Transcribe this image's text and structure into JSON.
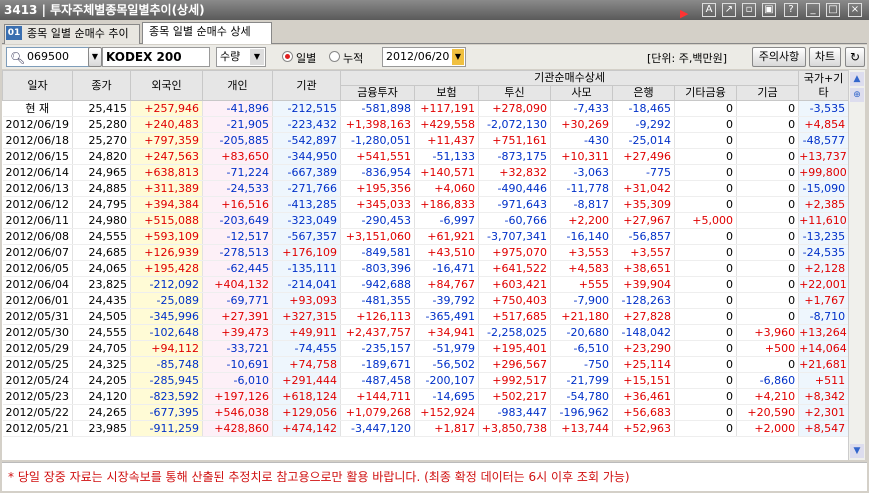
{
  "window": {
    "title": "3413 | 투자주체별종목일별추이(상세)"
  },
  "tabs": [
    {
      "label": "종목 일별 순매수 추이"
    },
    {
      "label": "종목 일별 순매수 상세"
    }
  ],
  "tab_badge": "01",
  "toolbar": {
    "code": "069500",
    "name": "KODEX 200",
    "unit_select": "수량",
    "radio_daily": "일별",
    "radio_cumulative": "누적",
    "date": "2012/06/20",
    "unit_label": "[단위: 주,백만원]",
    "notice_button": "주의사항",
    "chart_button": "차트"
  },
  "table": {
    "group_header": "기관순매수상세",
    "headers": [
      "일자",
      "종가",
      "외국인",
      "개인",
      "기관",
      "금융투자",
      "보험",
      "투신",
      "사모",
      "은행",
      "기타금융",
      "기금",
      "국가+기타"
    ],
    "rows": [
      [
        "현  재",
        "25,415",
        "+257,946",
        "-41,896",
        "-212,515",
        "-581,898",
        "+117,191",
        "+278,090",
        "-7,433",
        "-18,465",
        "0",
        "0",
        "-3,535"
      ],
      [
        "2012/06/19",
        "25,280",
        "+240,483",
        "-21,905",
        "-223,432",
        "+1,398,163",
        "+429,558",
        "-2,072,130",
        "+30,269",
        "-9,292",
        "0",
        "0",
        "+4,854"
      ],
      [
        "2012/06/18",
        "25,270",
        "+797,359",
        "-205,885",
        "-542,897",
        "-1,280,051",
        "+11,437",
        "+751,161",
        "-430",
        "-25,014",
        "0",
        "0",
        "-48,577"
      ],
      [
        "2012/06/15",
        "24,820",
        "+247,563",
        "+83,650",
        "-344,950",
        "+541,551",
        "-51,133",
        "-873,175",
        "+10,311",
        "+27,496",
        "0",
        "0",
        "+13,737"
      ],
      [
        "2012/06/14",
        "24,965",
        "+638,813",
        "-71,224",
        "-667,389",
        "-836,954",
        "+140,571",
        "+32,832",
        "-3,063",
        "-775",
        "0",
        "0",
        "+99,800"
      ],
      [
        "2012/06/13",
        "24,885",
        "+311,389",
        "-24,533",
        "-271,766",
        "+195,356",
        "+4,060",
        "-490,446",
        "-11,778",
        "+31,042",
        "0",
        "0",
        "-15,090"
      ],
      [
        "2012/06/12",
        "24,795",
        "+394,384",
        "+16,516",
        "-413,285",
        "+345,033",
        "+186,833",
        "-971,643",
        "-8,817",
        "+35,309",
        "0",
        "0",
        "+2,385"
      ],
      [
        "2012/06/11",
        "24,980",
        "+515,088",
        "-203,649",
        "-323,049",
        "-290,453",
        "-6,997",
        "-60,766",
        "+2,200",
        "+27,967",
        "+5,000",
        "0",
        "+11,610"
      ],
      [
        "2012/06/08",
        "24,555",
        "+593,109",
        "-12,517",
        "-567,357",
        "+3,151,060",
        "+61,921",
        "-3,707,341",
        "-16,140",
        "-56,857",
        "0",
        "0",
        "-13,235"
      ],
      [
        "2012/06/07",
        "24,685",
        "+126,939",
        "-278,513",
        "+176,109",
        "-849,581",
        "+43,510",
        "+975,070",
        "+3,553",
        "+3,557",
        "0",
        "0",
        "-24,535"
      ],
      [
        "2012/06/05",
        "24,065",
        "+195,428",
        "-62,445",
        "-135,111",
        "-803,396",
        "-16,471",
        "+641,522",
        "+4,583",
        "+38,651",
        "0",
        "0",
        "+2,128"
      ],
      [
        "2012/06/04",
        "23,825",
        "-212,092",
        "+404,132",
        "-214,041",
        "-942,688",
        "+84,767",
        "+603,421",
        "+555",
        "+39,904",
        "0",
        "0",
        "+22,001"
      ],
      [
        "2012/06/01",
        "24,435",
        "-25,089",
        "-69,771",
        "+93,093",
        "-481,355",
        "-39,792",
        "+750,403",
        "-7,900",
        "-128,263",
        "0",
        "0",
        "+1,767"
      ],
      [
        "2012/05/31",
        "24,505",
        "-345,996",
        "+27,391",
        "+327,315",
        "+126,113",
        "-365,491",
        "+517,685",
        "+21,180",
        "+27,828",
        "0",
        "0",
        "-8,710"
      ],
      [
        "2012/05/30",
        "24,555",
        "-102,648",
        "+39,473",
        "+49,911",
        "+2,437,757",
        "+34,941",
        "-2,258,025",
        "-20,680",
        "-148,042",
        "0",
        "+3,960",
        "+13,264"
      ],
      [
        "2012/05/29",
        "24,705",
        "+94,112",
        "-33,721",
        "-74,455",
        "-235,157",
        "-51,979",
        "+195,401",
        "-6,510",
        "+23,290",
        "0",
        "+500",
        "+14,064"
      ],
      [
        "2012/05/25",
        "24,325",
        "-85,748",
        "-10,691",
        "+74,758",
        "-189,671",
        "-56,502",
        "+296,567",
        "-750",
        "+25,114",
        "0",
        "0",
        "+21,681"
      ],
      [
        "2012/05/24",
        "24,205",
        "-285,945",
        "-6,010",
        "+291,444",
        "-487,458",
        "-200,107",
        "+992,517",
        "-21,799",
        "+15,151",
        "0",
        "-6,860",
        "+511"
      ],
      [
        "2012/05/23",
        "24,120",
        "-823,592",
        "+197,126",
        "+618,124",
        "+144,711",
        "-14,695",
        "+502,217",
        "-54,780",
        "+36,461",
        "0",
        "+4,210",
        "+8,342"
      ],
      [
        "2012/05/22",
        "24,265",
        "-677,395",
        "+546,038",
        "+129,056",
        "+1,079,268",
        "+152,924",
        "-983,447",
        "-196,962",
        "+56,683",
        "0",
        "+20,590",
        "+2,301"
      ],
      [
        "2012/05/21",
        "23,985",
        "-911,259",
        "+428,860",
        "+474,142",
        "-3,447,120",
        "+1,817",
        "+3,850,738",
        "+13,744",
        "+52,963",
        "0",
        "+2,000",
        "+8,547"
      ]
    ]
  },
  "footer_notice": "* 당일 장중 자료는 시장속보를 통해 산출된 추정치로 참고용으로만 활용 바랍니다. (최종 확정 데이터는 6시 이후 조회  가능)",
  "colors": {
    "positive": "#e00000",
    "negative": "#0030c8",
    "foreign_bg": "#fffbd6",
    "individual_bg": "#fdf0f7",
    "institution_bg": "#eef6fd"
  },
  "icons": [
    "search-icon",
    "dropdown-arrow-icon",
    "refresh-icon",
    "scroll-up-icon",
    "scroll-down-icon",
    "window-minimize-icon",
    "window-maximize-icon",
    "window-close-icon"
  ]
}
